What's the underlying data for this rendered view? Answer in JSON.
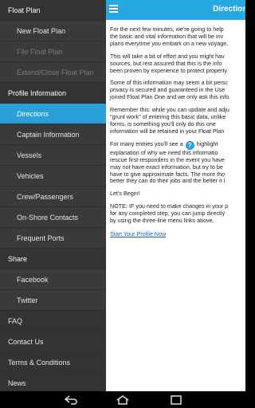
{
  "sidebar": {
    "items": [
      {
        "kind": "section",
        "name": "section-float-plan",
        "label": "Float Plan"
      },
      {
        "kind": "item",
        "name": "sidebar-item-new-float-plan",
        "label": "New Float Plan"
      },
      {
        "kind": "item-disabled",
        "name": "sidebar-item-file-float-plan",
        "label": "File Float Plan"
      },
      {
        "kind": "item-disabled",
        "name": "sidebar-item-extend-close-float-plan",
        "label": "Extend/Close Float Plan"
      },
      {
        "kind": "section",
        "name": "section-profile-information",
        "label": "Profile Information"
      },
      {
        "kind": "item-active",
        "name": "sidebar-item-directions",
        "label": "Directions"
      },
      {
        "kind": "item",
        "name": "sidebar-item-captain-information",
        "label": "Captain Information"
      },
      {
        "kind": "item",
        "name": "sidebar-item-vessels",
        "label": "Vessels"
      },
      {
        "kind": "item",
        "name": "sidebar-item-vehicles",
        "label": "Vehicles"
      },
      {
        "kind": "item",
        "name": "sidebar-item-crew-passengers",
        "label": "Crew/Passengers"
      },
      {
        "kind": "item",
        "name": "sidebar-item-on-shore-contacts",
        "label": "On-Shore Contacts"
      },
      {
        "kind": "item",
        "name": "sidebar-item-frequent-ports",
        "label": "Frequent Ports"
      },
      {
        "kind": "section",
        "name": "section-share",
        "label": "Share"
      },
      {
        "kind": "item",
        "name": "sidebar-item-facebook",
        "label": "Facebook"
      },
      {
        "kind": "item",
        "name": "sidebar-item-twitter",
        "label": "Twitter"
      },
      {
        "kind": "link",
        "name": "sidebar-item-faq",
        "label": "FAQ"
      },
      {
        "kind": "link",
        "name": "sidebar-item-contact-us",
        "label": "Contact Us"
      },
      {
        "kind": "link",
        "name": "sidebar-item-terms-conditions",
        "label": "Terms & Conditions"
      },
      {
        "kind": "link",
        "name": "sidebar-item-news",
        "label": "News"
      }
    ]
  },
  "header": {
    "title": "Directions",
    "menu_icon": "hamburger-menu-icon",
    "bar_color": "#26a9e0"
  },
  "content": {
    "p1": [
      "For the next few minutes, we're going to help",
      "the basic and vital information that will be inv",
      "plans everytime you embark on a new voyage."
    ],
    "p2": [
      "This will take a bit of effort and you might hav",
      "sources, but rest assured that this is the info",
      "been proven by experience to protect property"
    ],
    "p3": [
      "Some of this information may seem a bit persc",
      "privacy is secured and guaranteed in the Use",
      "joined Float Plan One and we only ask this info"
    ],
    "p4": [
      "Remember this: while you can update and adju",
      "\"grunt work\" of entering this basic data, unlike",
      "forms, is something you'll only do this one",
      "information will be retained in your Float Plan"
    ],
    "p5_line1_before": "For many entries you'll see a",
    "p5_icon_glyph": "?",
    "p5_line1_after": "highlight",
    "p5_rest": [
      "explanation of why we need this informatio",
      "rescue first-responders in the event you have",
      "may not have exact information, but try to be",
      "have to give approximate facts. The more tho",
      "better they can do their jobs and the better it i"
    ],
    "p6": "Let's Begin!",
    "p7": [
      "NOTE: IF you need to make changes in your p",
      "for any completed step, you can jump directly",
      "by using the three-line menu links above."
    ],
    "start_link": "Start Your Profile Now"
  },
  "navbar": {
    "buttons": [
      "back-icon",
      "home-icon",
      "recent-apps-icon"
    ]
  },
  "colors": {
    "accent": "#2aa0d8",
    "sidebar_bg": "#3a3a3a"
  }
}
